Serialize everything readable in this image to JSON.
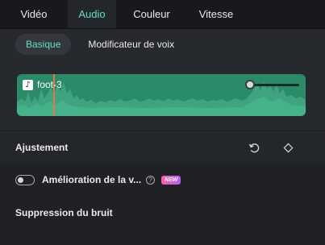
{
  "tabs": [
    {
      "label": "Vidéo",
      "active": false
    },
    {
      "label": "Audio",
      "active": true
    },
    {
      "label": "Couleur",
      "active": false
    },
    {
      "label": "Vitesse",
      "active": false
    }
  ],
  "subtabs": [
    {
      "label": "Basique",
      "active": true
    },
    {
      "label": "Modificateur de voix",
      "active": false
    }
  ],
  "clip": {
    "name": "foot-3",
    "icon": "music-note-icon"
  },
  "adjustment": {
    "label": "Ajustement",
    "icons": [
      "reset-icon",
      "keyframe-diamond-icon"
    ]
  },
  "enhancement": {
    "label": "Amélioration de la v...",
    "toggle_on": false,
    "badge": "NEW",
    "help_icon": "help-circle-icon"
  },
  "noise": {
    "label": "Suppression du bruit"
  },
  "colors": {
    "accent": "#5fe0c4",
    "waveform_bg": "#2b8a68",
    "playhead": "#e07a3e"
  }
}
